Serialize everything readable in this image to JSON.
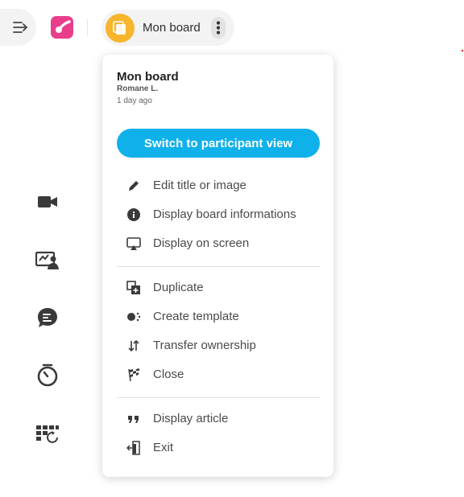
{
  "header": {
    "board_name": "Mon board"
  },
  "rail": {
    "icons": [
      "video-camera-icon",
      "participants-board-icon",
      "chat-icon",
      "timer-icon",
      "grid-refresh-icon"
    ]
  },
  "menu": {
    "title": "Mon board",
    "author": "Romane L.",
    "date": "1 day ago",
    "switch_label": "Switch to participant view",
    "items": [
      {
        "label": "Edit title or image",
        "icon": "pencil-icon"
      },
      {
        "label": "Display board informations",
        "icon": "info-icon"
      },
      {
        "label": "Display on screen",
        "icon": "screen-cast-icon"
      },
      {
        "label": "Duplicate",
        "icon": "duplicate-icon"
      },
      {
        "label": "Create template",
        "icon": "template-icon"
      },
      {
        "label": "Transfer ownership",
        "icon": "transfer-icon"
      },
      {
        "label": "Close",
        "icon": "checkered-flag-icon"
      },
      {
        "label": "Display article",
        "icon": "quote-icon"
      },
      {
        "label": "Exit",
        "icon": "exit-icon"
      }
    ]
  },
  "colors": {
    "accent": "#0fb1ea",
    "logo": "#e83e8c",
    "board_avatar": "#f7b52c"
  }
}
